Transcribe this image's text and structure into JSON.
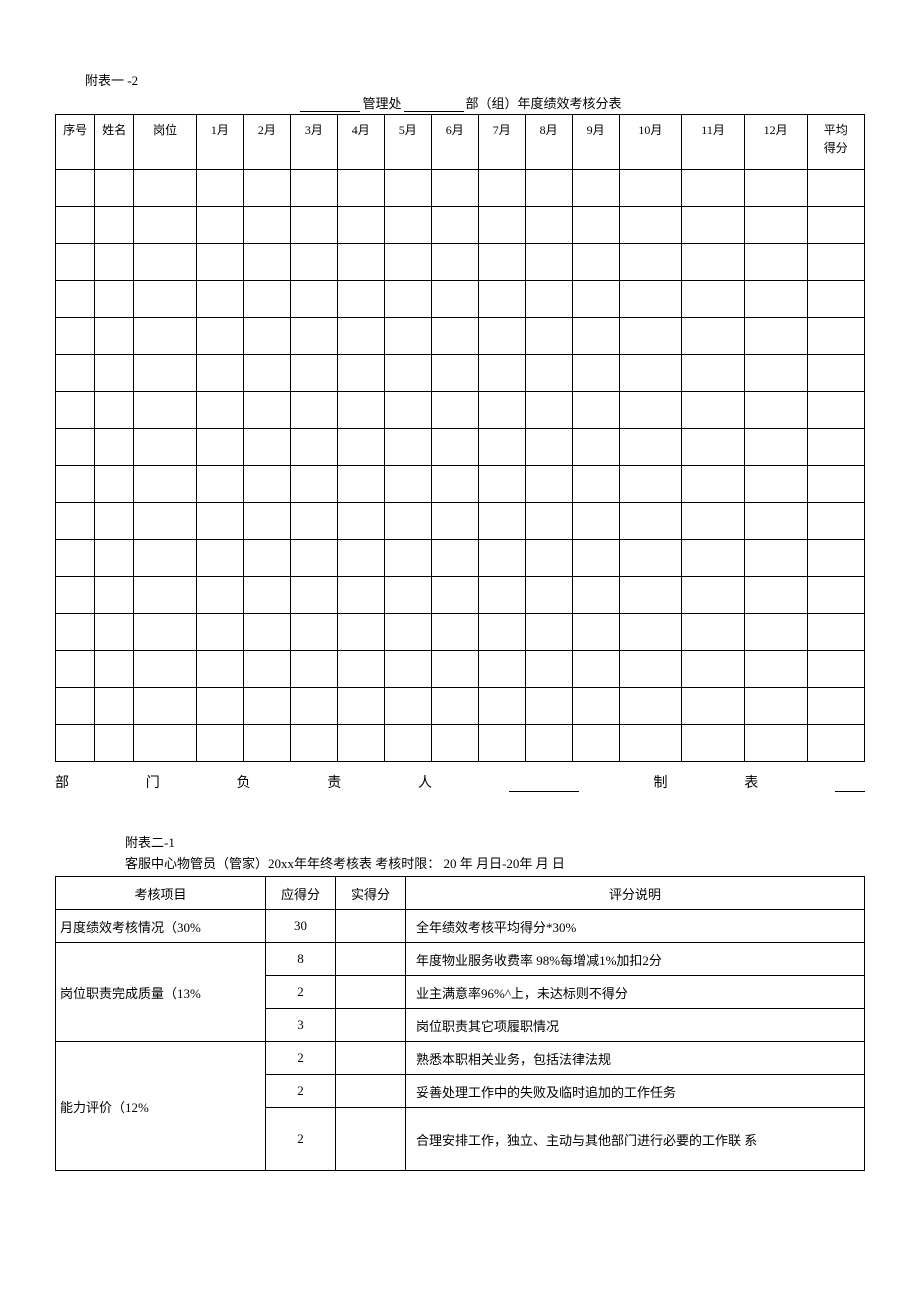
{
  "section1": {
    "top_label": "附表一 -2",
    "title_mid1": "管理处",
    "title_mid2": "部（组）年度绩效考核分表",
    "headers": {
      "c0": "序号",
      "c1": "姓名",
      "c2": "岗位",
      "c3": "1月",
      "c4": "2月",
      "c5": "3月",
      "c6": "4月",
      "c7": "5月",
      "c8": "6月",
      "c9": "7月",
      "c10": "8月",
      "c11": "9月",
      "c12": "10月",
      "c13": "11月",
      "c14": "12月",
      "c15": "平均\n得分"
    },
    "footer": {
      "p1": "部",
      "p2": "门",
      "p3": "负",
      "p4": "责",
      "p5": "人",
      "p6": "制",
      "p7": "表"
    }
  },
  "section2": {
    "top_label": "附表二-1",
    "title": "客服中心物管员（管家）20xx年年终考核表 考核时限： 20 年 月日-20年 月 日",
    "headers": {
      "h0": "考核项目",
      "h1": "应得分",
      "h2": "实得分",
      "h3": "评分说明"
    },
    "rows": {
      "r0_item": "月度绩效考核情况（30%",
      "r0_score": "30",
      "r0_desc": "全年绩效考核平均得分*30%",
      "r1_item": "岗位职责完成质量（13%",
      "r1a_score": "8",
      "r1a_desc": "年度物业服务收费率 98%每增减1%加扣2分",
      "r1b_score": "2",
      "r1b_desc": "业主满意率96%^上，未达标则不得分",
      "r1c_score": "3",
      "r1c_desc": "岗位职责其它项履职情况",
      "r2_item": "能力评价（12%",
      "r2a_score": "2",
      "r2a_desc": "熟悉本职相关业务，包括法律法规",
      "r2b_score": "2",
      "r2b_desc": "妥善处理工作中的失败及临时追加的工作任务",
      "r2c_score": "2",
      "r2c_desc": "合理安排工作，独立、主动与其他部门进行必要的工作联 系"
    }
  }
}
